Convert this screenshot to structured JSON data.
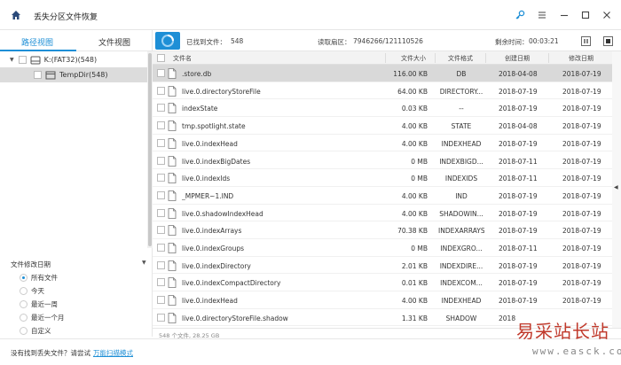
{
  "app": {
    "title": "丢失分区文件恢复"
  },
  "left": {
    "tabs": [
      {
        "label": "路径视图"
      },
      {
        "label": "文件视图"
      }
    ],
    "tree": [
      {
        "label": "K:(FAT32)(548)"
      },
      {
        "label": "TempDir(548)"
      }
    ],
    "filter": {
      "title": "文件修改日期",
      "options": [
        "所有文件",
        "今天",
        "最近一周",
        "最近一个月",
        "自定义"
      ]
    }
  },
  "status": {
    "found_label": "已找到文件：",
    "found_value": "548",
    "sectors_label": "读取扇区：",
    "sectors_value": "7946266/121110526",
    "remaining_label": "剩余时间：",
    "remaining_value": "00:03:21"
  },
  "table": {
    "headers": [
      "文件名",
      "文件大小",
      "文件格式",
      "创建日期",
      "修改日期"
    ],
    "rows": [
      {
        "name": ".store.db",
        "size": "116.00 KB",
        "format": "DB",
        "created": "2018-04-08",
        "modified": "2018-07-19"
      },
      {
        "name": "live.0.directoryStoreFile",
        "size": "64.00 KB",
        "format": "DIRECTORY...",
        "created": "2018-07-19",
        "modified": "2018-07-19"
      },
      {
        "name": "indexState",
        "size": "0.03 KB",
        "format": "--",
        "created": "2018-07-19",
        "modified": "2018-07-19"
      },
      {
        "name": "tmp.spotlight.state",
        "size": "4.00 KB",
        "format": "STATE",
        "created": "2018-04-08",
        "modified": "2018-07-19"
      },
      {
        "name": "live.0.indexHead",
        "size": "4.00 KB",
        "format": "INDEXHEAD",
        "created": "2018-07-19",
        "modified": "2018-07-19"
      },
      {
        "name": "live.0.indexBigDates",
        "size": "0 MB",
        "format": "INDEXBIGD...",
        "created": "2018-07-11",
        "modified": "2018-07-19"
      },
      {
        "name": "live.0.indexIds",
        "size": "0 MB",
        "format": "INDEXIDS",
        "created": "2018-07-11",
        "modified": "2018-07-19"
      },
      {
        "name": "_MPMER~1.IND",
        "size": "4.00 KB",
        "format": "IND",
        "created": "2018-07-19",
        "modified": "2018-07-19"
      },
      {
        "name": "live.0.shadowIndexHead",
        "size": "4.00 KB",
        "format": "SHADOWIN...",
        "created": "2018-07-19",
        "modified": "2018-07-19"
      },
      {
        "name": "live.0.indexArrays",
        "size": "70.38 KB",
        "format": "INDEXARRAYS",
        "created": "2018-07-19",
        "modified": "2018-07-19"
      },
      {
        "name": "live.0.indexGroups",
        "size": "0 MB",
        "format": "INDEXGRO...",
        "created": "2018-07-11",
        "modified": "2018-07-19"
      },
      {
        "name": "live.0.indexDirectory",
        "size": "2.01 KB",
        "format": "INDEXDIRE...",
        "created": "2018-07-19",
        "modified": "2018-07-19"
      },
      {
        "name": "live.0.indexCompactDirectory",
        "size": "0.01 KB",
        "format": "INDEXCOM...",
        "created": "2018-07-19",
        "modified": "2018-07-19"
      },
      {
        "name": "live.0.indexHead",
        "size": "4.00 KB",
        "format": "INDEXHEAD",
        "created": "2018-07-19",
        "modified": "2018-07-19"
      },
      {
        "name": "live.0.directoryStoreFile.shadow",
        "size": "1.31 KB",
        "format": "SHADOW",
        "created": "2018",
        "modified": ""
      }
    ],
    "footer": "548 个文件, 28.25 GB"
  },
  "bottom": {
    "prompt": "没有找到丢失文件？请尝试",
    "link": "万能扫描模式"
  },
  "watermark": {
    "big": "易采站长站",
    "small": "www.easck.com"
  },
  "colors": {
    "accent": "#1e8fd6",
    "selected_row": "#d9d9d9"
  }
}
